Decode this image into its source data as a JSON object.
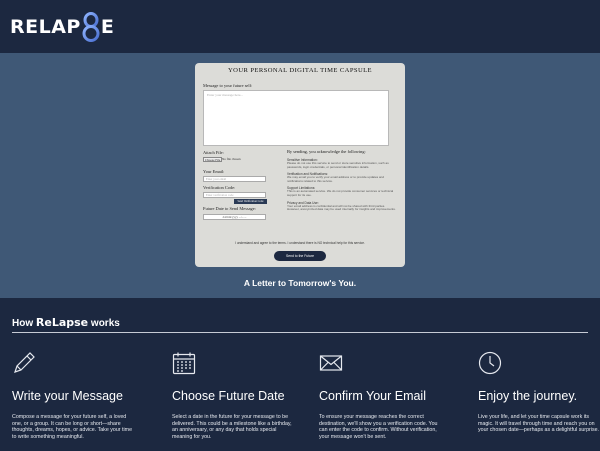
{
  "brand": {
    "left": "RELAP",
    "right": "E"
  },
  "capsule": {
    "title": "YOUR PERSONAL DIGITAL TIME CAPSULE",
    "message_label": "Message to your future self:",
    "message_placeholder": "Enter your message here...",
    "attach_label": "Attach File:",
    "choose_file_label": "Choose File",
    "no_file_text": "No file chosen",
    "email_label": "Your Email:",
    "email_placeholder": "Enter your email",
    "code_label": "Verification Code:",
    "code_placeholder": "Enter verification code",
    "send_code_label": "Send Verification Code",
    "date_label": "Future Date to Send Message:",
    "date_value": "dd/mm/yyyy  --:-- --",
    "ack_title": "By sending, you acknowledge the following:",
    "ack_items": [
      {
        "heading": "Sensitive Information:",
        "text": "Please do not use this service to send or store sensitive information, such as passwords, login credentials, or personal identification details."
      },
      {
        "heading": "Verification and Notifications:",
        "text": "We may email you to verify your email address or to provide updates and notifications related to this service."
      },
      {
        "heading": "Support Limitations:",
        "text": "This is an automated service. We do not provide consumer services or technical support for its use."
      },
      {
        "heading": "Privacy and Data Use:",
        "text": "Your email address is confidential and will not be shared with third parties. However, anonymized data may be used internally for insights and improvements."
      }
    ],
    "agree_text": "I understand and agree to the terms. I understand there is NO technical help for this service.",
    "send_button": "Send to the Future"
  },
  "tagline": "A Letter to Tomorrow's You.",
  "how": {
    "title_prefix": "How",
    "title_brand": "ReLapse",
    "title_suffix": "works",
    "steps": [
      {
        "icon": "pencil-icon",
        "title": "Write your Message",
        "desc": "Compose a message for your future self, a loved one, or a group. It can be long or short—share thoughts, dreams, hopes, or advice. Take your time to write something meaningful."
      },
      {
        "icon": "calendar-icon",
        "title": "Choose Future Date",
        "desc": "Select a date in the future for your message to be delivered. This could be a milestone like a birthday, an anniversary, or any day that holds special meaning for you."
      },
      {
        "icon": "envelope-icon",
        "title": "Confirm Your Email",
        "desc": "To ensure your message reaches the correct destination, we'll show you a verification code. You can enter the code to confirm. Without verification, your message won't be sent."
      },
      {
        "icon": "clock-icon",
        "title": "Enjoy the journey.",
        "desc": "Live your life, and let your time capsule work its magic. It will travel through time and reach you on your chosen date—perhaps as a delightful surprise."
      }
    ]
  },
  "colors": {
    "navy": "#1c2840",
    "hero": "#3f5876",
    "accent": "#6a8fd6"
  }
}
